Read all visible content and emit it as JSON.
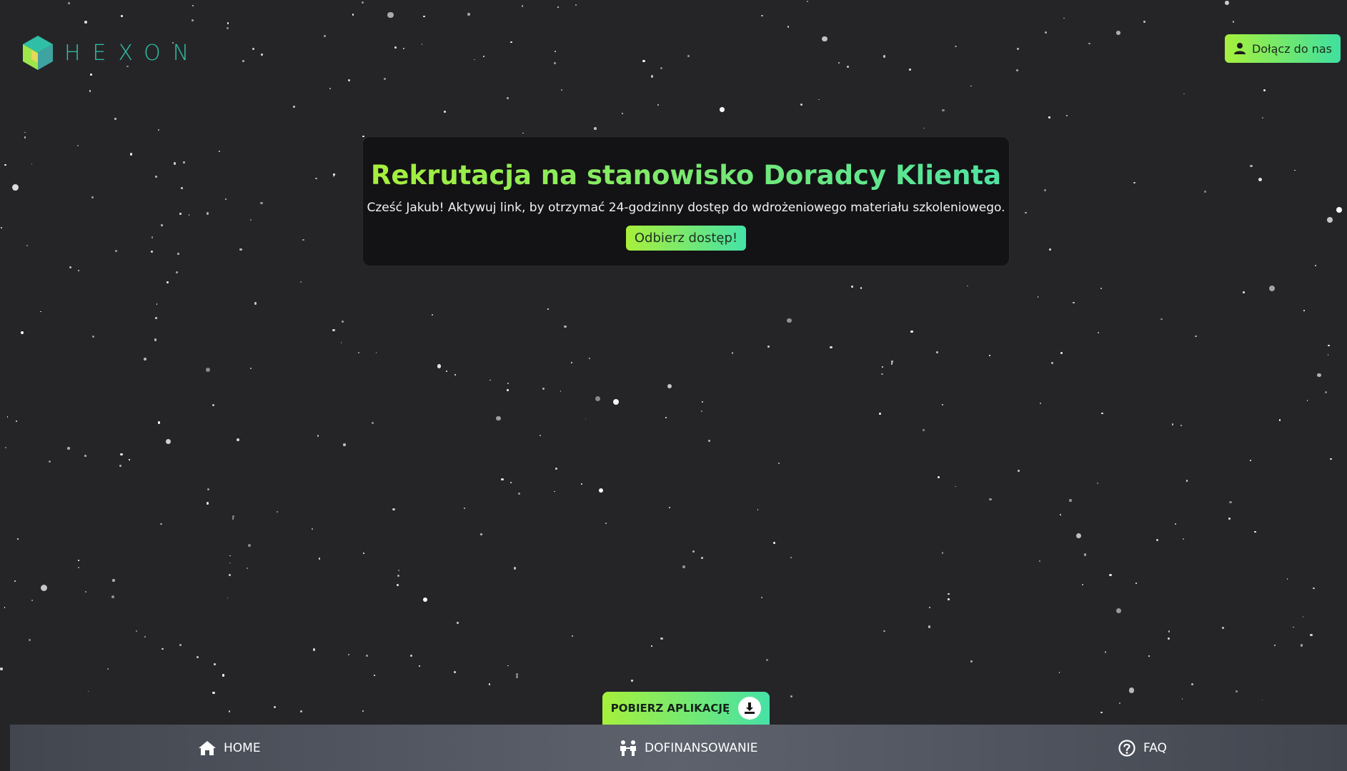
{
  "brand": {
    "name": "HEXON",
    "accent": "#2fbfa6",
    "gradient_start": "#a8ef3a",
    "gradient_end": "#45e2a8"
  },
  "header": {
    "join_label": "Dołącz do nas",
    "join_icon": "user-icon"
  },
  "hero": {
    "title": "Rekrutacja na stanowisko Doradcy Klienta",
    "subtitle": "Cześć Jakub! Aktywuj link, by otrzymać 24-godzinny dostęp do wdrożeniowego materiału szkoleniowego.",
    "cta_label": "Odbierz dostęp!"
  },
  "download": {
    "label": "POBIERZ APLIKACJĘ",
    "icon": "download-icon"
  },
  "nav": {
    "items": [
      {
        "label": "HOME",
        "icon": "home-icon"
      },
      {
        "label": "DOFINANSOWANIE",
        "icon": "people-icon"
      },
      {
        "label": "FAQ",
        "icon": "question-circle-icon"
      }
    ]
  }
}
